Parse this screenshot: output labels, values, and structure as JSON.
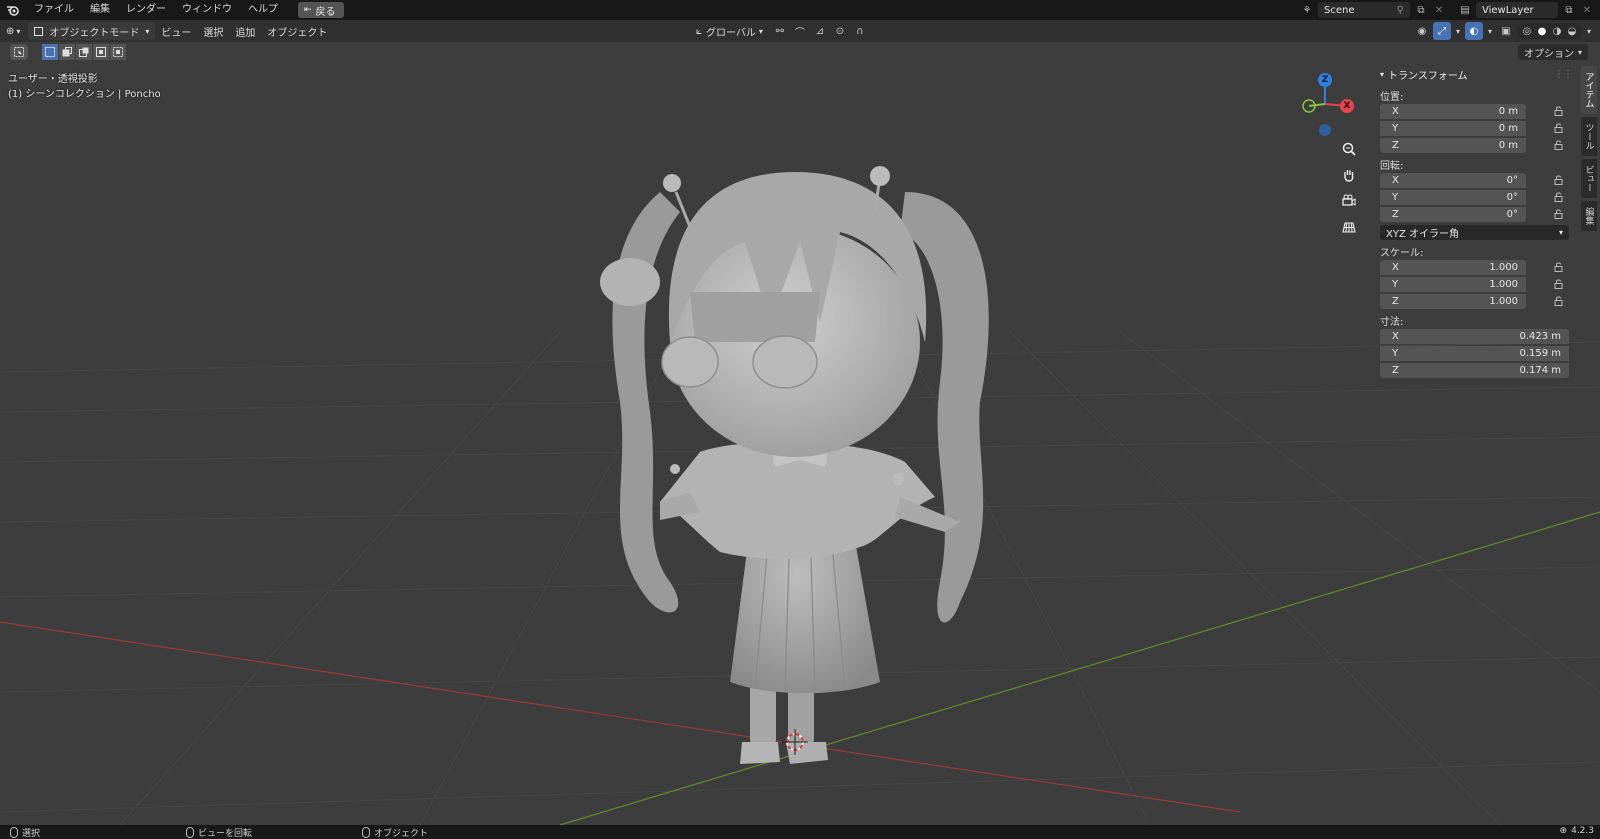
{
  "topbar": {
    "menu": [
      "ファイル",
      "編集",
      "レンダー",
      "ウィンドウ",
      "ヘルプ"
    ],
    "back_label": "戻る",
    "scene_name": "Scene",
    "view_layer": "ViewLayer"
  },
  "header": {
    "mode": "オブジェクトモード",
    "menus": [
      "ビュー",
      "選択",
      "追加",
      "オブジェクト"
    ],
    "orientation": "グローバル",
    "options_label": "オプション"
  },
  "viewport": {
    "view_label": "ユーザー・透視投影",
    "collection_label": "(1) シーンコレクション | Poncho",
    "gizmo_axes": {
      "x": "X",
      "y": "Y",
      "z": "Z"
    },
    "colors": {
      "x": "#e8424c",
      "y": "#8bc43c",
      "z": "#2f7fe0",
      "x_line": "#a33a3a",
      "y_line": "#6b8a2a"
    }
  },
  "npanel": {
    "title": "トランスフォーム",
    "location_label": "位置:",
    "location": [
      {
        "axis": "X",
        "value": "0 m"
      },
      {
        "axis": "Y",
        "value": "0 m"
      },
      {
        "axis": "Z",
        "value": "0 m"
      }
    ],
    "rotation_label": "回転:",
    "rotation": [
      {
        "axis": "X",
        "value": "0°"
      },
      {
        "axis": "Y",
        "value": "0°"
      },
      {
        "axis": "Z",
        "value": "0°"
      }
    ],
    "rotation_mode": "XYZ オイラー角",
    "scale_label": "スケール:",
    "scale": [
      {
        "axis": "X",
        "value": "1.000"
      },
      {
        "axis": "Y",
        "value": "1.000"
      },
      {
        "axis": "Z",
        "value": "1.000"
      }
    ],
    "dimensions_label": "寸法:",
    "dimensions": [
      {
        "axis": "X",
        "value": "0.423 m"
      },
      {
        "axis": "Y",
        "value": "0.159 m"
      },
      {
        "axis": "Z",
        "value": "0.174 m"
      }
    ]
  },
  "side_tabs": [
    "アイテム",
    "ツール",
    "ビュー",
    "編集"
  ],
  "statusbar": {
    "select": "選択",
    "rotate_view": "ビューを回転",
    "object": "オブジェクト",
    "version": "4.2.3"
  }
}
